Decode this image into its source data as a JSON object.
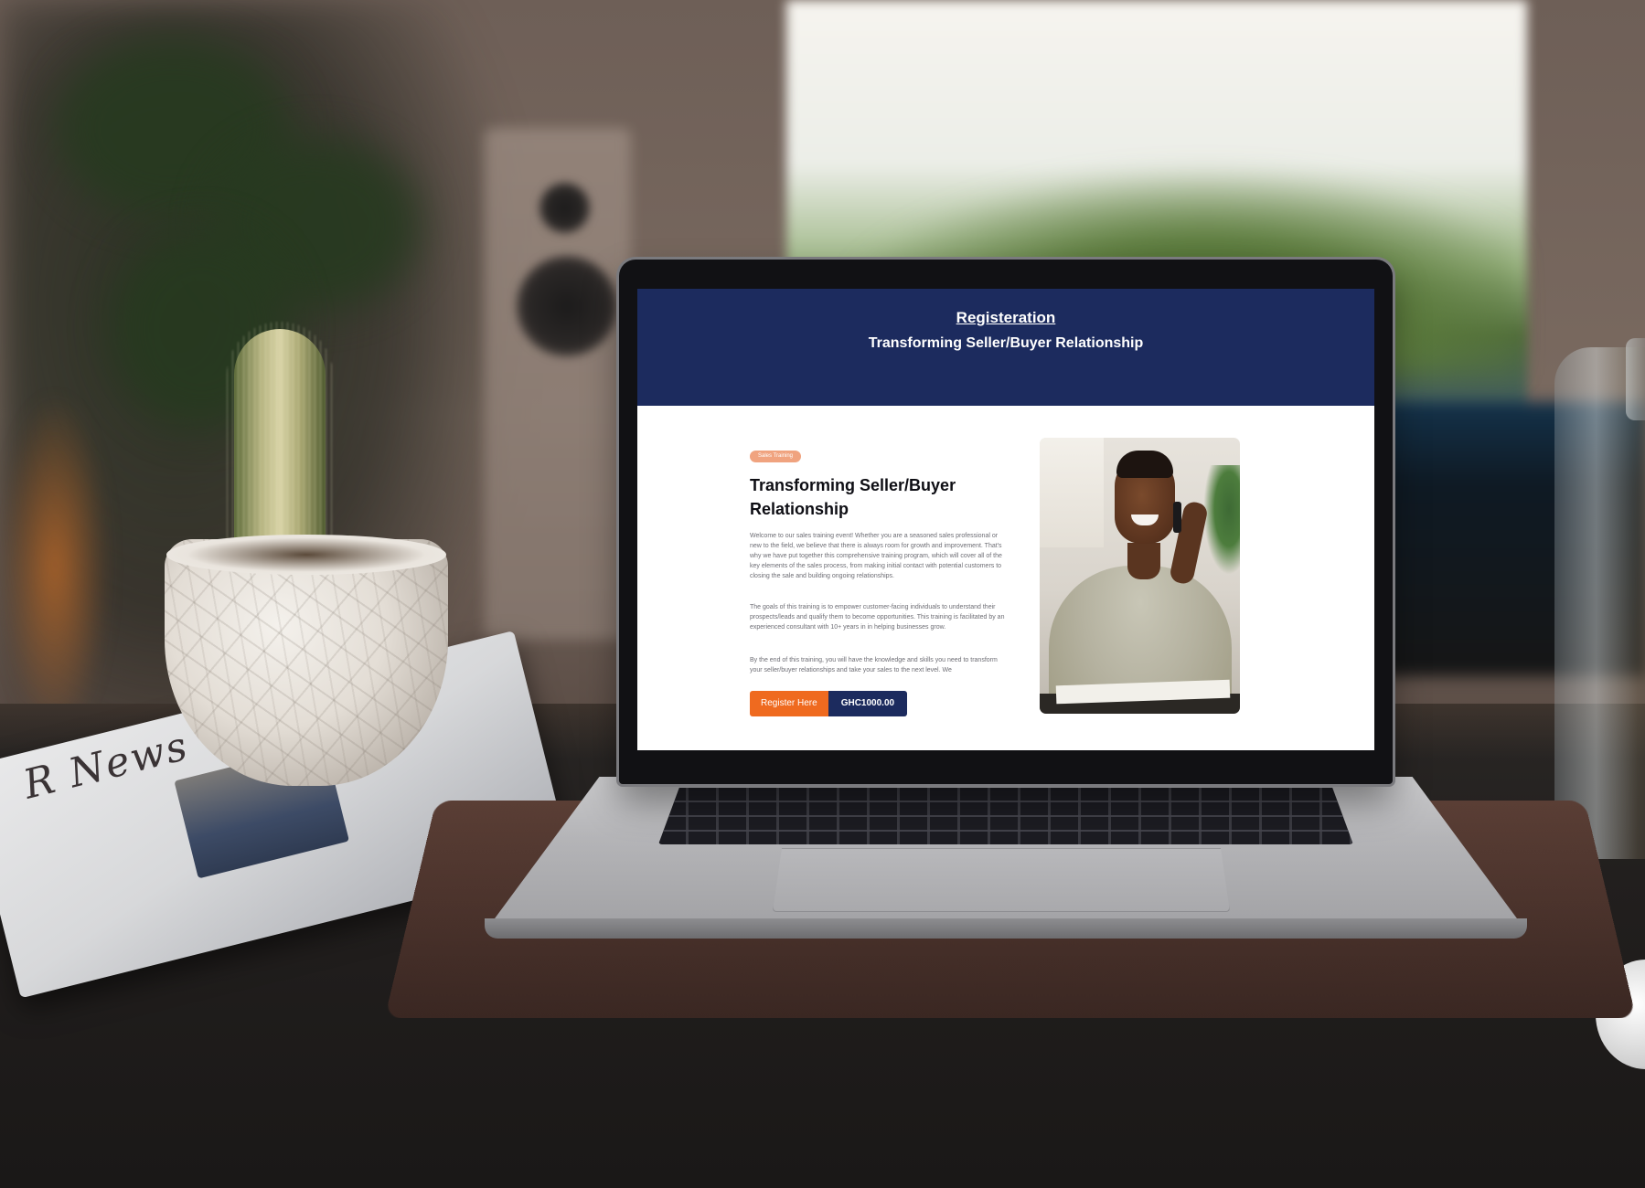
{
  "page": {
    "header_title": "Registeration",
    "header_subtitle": "Transforming Seller/Buyer Relationship"
  },
  "course": {
    "tag": "Sales Training",
    "title": "Transforming Seller/Buyer Relationship",
    "paragraphs": [
      "Welcome to our sales training event! Whether you are a seasoned sales professional or new to the field, we believe that there is always room for growth and improvement. That's why we have put together this comprehensive training program, which will cover all of the key elements of the sales process, from making initial contact with potential customers to closing the sale and building ongoing relationships.",
      "The goals of this training is to empower customer-facing individuals to understand their prospects/leads and qualify them to become opportunities. This training is facilitated by an experienced consultant with 10+ years in in helping businesses grow.",
      "By the end of this training, you will have the knowledge and skills you need to transform your seller/buyer relationships and take your sales to the next level. We"
    ],
    "register_label": "Register Here",
    "price": "GHC1000.00"
  },
  "scene": {
    "newspaper_masthead": "R News"
  },
  "colors": {
    "header_bg": "#1c2b5e",
    "accent_orange": "#ef6a1f",
    "tag_bg": "#f0a37f"
  }
}
